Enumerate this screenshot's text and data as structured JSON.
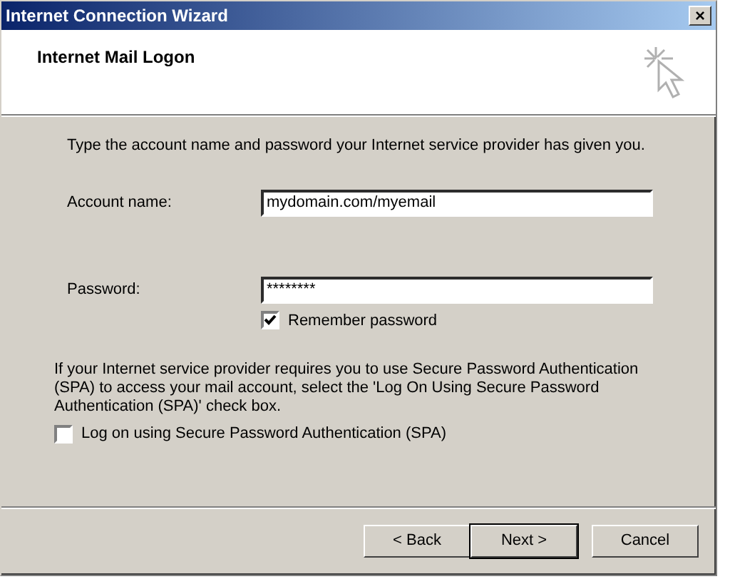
{
  "window": {
    "title": "Internet Connection Wizard",
    "close": "×"
  },
  "header": {
    "title": "Internet Mail Logon"
  },
  "intro": "Type the account name and password your Internet service provider has given you.",
  "fields": [
    {
      "label": "Account name:",
      "value": "mydomain.com/myemail"
    },
    {
      "label": "Password:",
      "value": "********"
    }
  ],
  "remember": {
    "label": "Remember password",
    "checked": true
  },
  "spa_note": "If your Internet service provider requires you to use Secure Password Authentication (SPA) to access your mail account, select the 'Log On Using Secure Password Authentication (SPA)' check box.",
  "spa": {
    "label": "Log on using Secure Password Authentication (SPA)",
    "checked": false
  },
  "buttons": [
    {
      "label": "< Back",
      "default": false
    },
    {
      "label": "Next >",
      "default": true
    },
    {
      "label": "Cancel",
      "default": false
    }
  ]
}
